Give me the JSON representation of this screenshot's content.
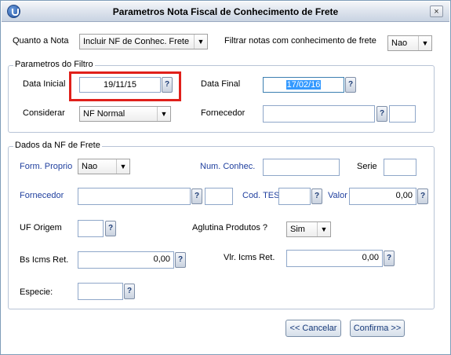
{
  "window": {
    "title": "Parametros Nota Fiscal de Conhecimento de Frete",
    "close": "×"
  },
  "top": {
    "quanto_label": "Quanto a Nota",
    "quanto_value": "Incluir NF de Conhec. Frete",
    "filtrar_label": "Filtrar notas com conhecimento de frete",
    "filtrar_value": "Nao"
  },
  "filtro": {
    "title": "Parametros do Filtro",
    "data_inicial_label": "Data Inicial",
    "data_inicial_value": "19/11/15",
    "data_final_label": "Data Final",
    "data_final_value": "17/02/16",
    "considerar_label": "Considerar",
    "considerar_value": "NF Normal",
    "fornecedor_label": "Fornecedor",
    "fornecedor_value": "",
    "fornecedor_loja": ""
  },
  "frete": {
    "title": "Dados da NF de Frete",
    "form_proprio_label": "Form. Proprio",
    "form_proprio_value": "Nao",
    "num_conhec_label": "Num. Conhec.",
    "num_conhec_value": "",
    "serie_label": "Serie",
    "serie_value": "",
    "fornecedor_label": "Fornecedor",
    "fornecedor_value": "",
    "fornecedor_loja": "",
    "cod_tes_label": "Cod. TES",
    "cod_tes_value": "",
    "valor_label": "Valor",
    "valor_value": "0,00",
    "uf_origem_label": "UF Origem",
    "uf_origem_value": "",
    "aglutina_label": "Aglutina Produtos ?",
    "aglutina_value": "Sim",
    "bs_icms_label": "Bs Icms Ret.",
    "bs_icms_value": "0,00",
    "vlr_icms_label": "Vlr. Icms Ret.",
    "vlr_icms_value": "0,00",
    "especie_label": "Especie:",
    "especie_value": ""
  },
  "buttons": {
    "cancelar": "<< Cancelar",
    "confirma": "Confirma >>"
  },
  "icons": {
    "lookup": "?",
    "dropdown": "▼"
  },
  "colors": {
    "highlight": "#e0201b",
    "label_blue": "#1f3f9e",
    "selection": "#3399ff"
  }
}
